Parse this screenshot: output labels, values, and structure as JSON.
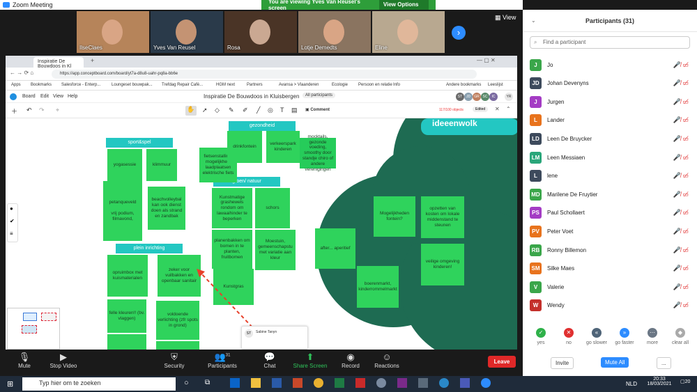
{
  "zoom": {
    "title": "Zoom Meeting",
    "viewing_banner": "You are viewing Yves Van Reusel's screen",
    "view_options": "View Options",
    "view_button": "View",
    "thumbnails": [
      {
        "name": "IlseClaes"
      },
      {
        "name": "Yves Van Reusel"
      },
      {
        "name": "Rosa"
      },
      {
        "name": "Lotje Demedts"
      },
      {
        "name": "Eline"
      }
    ],
    "toolbar": {
      "mute": "Mute",
      "stop_video": "Stop Video",
      "security": "Security",
      "participants": "Participants",
      "participants_count": "31",
      "chat": "Chat",
      "share_screen": "Share Screen",
      "record": "Record",
      "reactions": "Reactions",
      "leave": "Leave"
    }
  },
  "browser": {
    "tab_label": "Inspiratie De Bouwdoos in Kl",
    "url": "https://app.conceptboard.com/board/yt7a-d8u8-uahr-pq8a-bb6e",
    "bookmarks": [
      "Apps",
      "Bookmarks",
      "Salesforce - Enterp...",
      "Loungeset bouwpak...",
      "Trefdag Repair Café...",
      "HGM next",
      "Partners",
      "Avansa > Vlaanderen",
      "Ecologie",
      "Persoon en relatie",
      "Info",
      "Andere bookmarks",
      "Leeslijst"
    ]
  },
  "conceptboard": {
    "menu": [
      "Board",
      "Edit",
      "View",
      "Help"
    ],
    "board_title": "Inspiratie De Bouwdoos in Kluisbergen",
    "all_participants": "All participants",
    "avatars": [
      "ST",
      "JD",
      "GR",
      "SC",
      "IC",
      "YR"
    ],
    "comment": "Comment",
    "objects_count": "117/100 objects",
    "edit_badge": "Edited",
    "headers": {
      "sport_spel": "sport&spel",
      "gezondheid": "gezondheid",
      "groen_natuur": "groen/ natuur",
      "plein_inrichting": "plein inrichting",
      "ideeenwolk": "ideeenwolk"
    },
    "notes": {
      "yogasessie": "yogasessie",
      "klimmuur": "klimmuur",
      "petanque": "petanqueveld\n\nvrij podium, filmavond,",
      "beachvolleybal": "beachvolleybal kan ook dienst doen als strand en zandbak",
      "fietsenstalling": "fietsenstalling, mogelijkheid laadplaatsen elektrische fiets",
      "drinkfontein": "drinkfontein",
      "verkeersparkje": "verkeerspark kinderen",
      "mocktails": "mocktails, gezonde voeding, smoothy door standje chiro of andere verenigingen",
      "kunstmatige": "Kunstmatige grashewels rondom om lawaaihinder te beperken",
      "schors": "schors",
      "planenbakken": "planenbakken om bomen in te planten, fruitbomen",
      "moestuin": "Moestuin, gemeenschapstu met variatie aan kleur",
      "kunstgras": "Kunstgras",
      "opruimbox": "opruimbox met kuismaterialen",
      "zeker": "zeker voor vuilbakken en openbaar sanitair",
      "felle_kleuren": "felle kleuren!! (bv. vlaggen)",
      "verlichting": "voldoende verlichting (zfr spots in grond)",
      "after": "after... aperitief",
      "mogelijkheden": "Mogelijkheden fontein?",
      "opzetten": "opzetten van kosten om lokale middenstand te steunen",
      "boerenmarkt": "boerenmarkt, kinderrommelmarkt",
      "veilige": "veilige omgeving kinderen!"
    },
    "comment_card": {
      "initials": "ST",
      "name": "Sabine Tanyn"
    }
  },
  "participants_panel": {
    "title": "Participants (31)",
    "find_placeholder": "Find a participant",
    "list": [
      {
        "initial": "J",
        "name": "Jo",
        "color": "#3aa64a"
      },
      {
        "initial": "JD",
        "name": "Johan Devenyns",
        "color": "#3d4a5c"
      },
      {
        "initial": "J",
        "name": "Jurgen",
        "color": "#a43cc4"
      },
      {
        "initial": "L",
        "name": "Lander",
        "color": "#e8731d"
      },
      {
        "initial": "LD",
        "name": "Leen De Bruycker",
        "color": "#3d4a5c"
      },
      {
        "initial": "LM",
        "name": "Leen Messiaen",
        "color": "#2aa67a"
      },
      {
        "initial": "L",
        "name": "lene",
        "color": "#3d4a5c"
      },
      {
        "initial": "MD",
        "name": "Marilene De Fruytier",
        "color": "#3aa64a"
      },
      {
        "initial": "PS",
        "name": "Paul Schollaert",
        "color": "#a43cc4"
      },
      {
        "initial": "PV",
        "name": "Peter Voet",
        "color": "#e8731d"
      },
      {
        "initial": "RB",
        "name": "Ronny Billemon",
        "color": "#3aa64a"
      },
      {
        "initial": "SM",
        "name": "Silke Maes",
        "color": "#e8731d"
      },
      {
        "initial": "V",
        "name": "Valerie",
        "color": "#3aa64a"
      },
      {
        "initial": "W",
        "name": "Wendy",
        "color": "#c4302b"
      }
    ],
    "reactions": [
      "yes",
      "no",
      "go slower",
      "go faster",
      "more",
      "clear all"
    ],
    "invite": "Invite",
    "mute_all": "Mute All",
    "more": "..."
  },
  "taskbar": {
    "search_placeholder": "Typ hier om te zoeken",
    "lang": "NLD",
    "time": "20:33",
    "date": "18/03/2021",
    "notif": "20"
  }
}
